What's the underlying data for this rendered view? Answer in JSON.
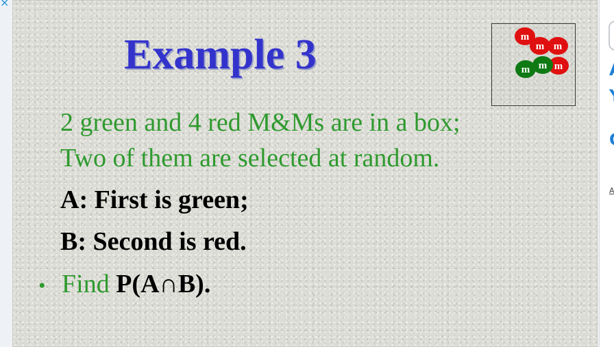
{
  "window": {
    "close_glyph": "×",
    "accent_color": "#1e8fd6"
  },
  "slide": {
    "title": "Example 3",
    "image": {
      "name": "mms-candies",
      "labels": [
        "m",
        "m",
        "m",
        "m",
        "m",
        "m"
      ],
      "colors": {
        "red": "#e01010",
        "green": "#0f7a14"
      }
    },
    "line1": "2 green and 4 red M&Ms  are in a box;",
    "line2": "Two of them are selected at random.",
    "event_a": "A: First is green;",
    "event_b": "B: Second is red.",
    "bullet": "•",
    "find_label": "Find",
    "find_expression": "P(A∩B)."
  },
  "side_strip": {
    "letters": [
      "A",
      "Y",
      "C"
    ],
    "small_text": "A"
  }
}
